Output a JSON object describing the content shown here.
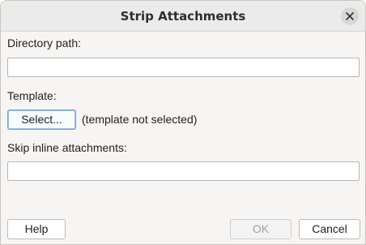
{
  "window": {
    "title": "Strip Attachments",
    "close_icon": "close-icon"
  },
  "form": {
    "directory_label": "Directory path:",
    "directory_value": "",
    "template_label": "Template:",
    "select_button_label": "Select...",
    "template_status": "(template not selected)",
    "skip_inline_label": "Skip inline attachments:",
    "skip_inline_value": ""
  },
  "footer": {
    "help_label": "Help",
    "ok_label": "OK",
    "cancel_label": "Cancel"
  }
}
